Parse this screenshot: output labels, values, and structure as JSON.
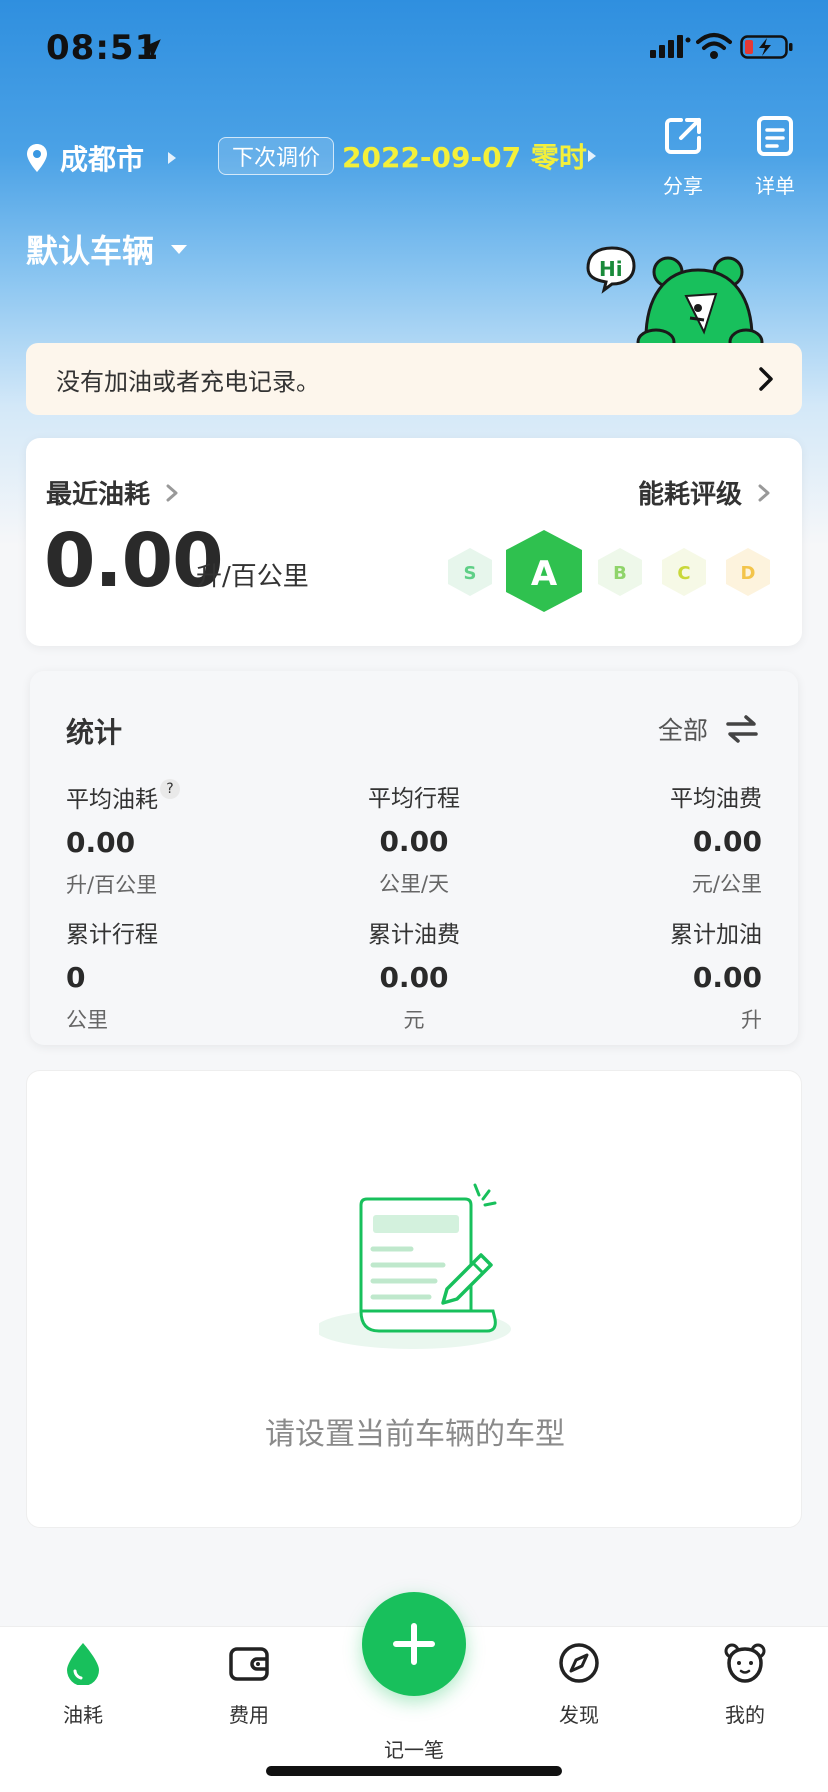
{
  "status_bar": {
    "time": "08:51"
  },
  "header": {
    "city": "成都市",
    "price_badge": "下次调价",
    "price_date": "2022-09-07 零时",
    "share_label": "分享",
    "detail_label": "详单",
    "vehicle": "默认车辆",
    "mascot_greeting": "Hi"
  },
  "notice": {
    "text": "没有加油或者充电记录。"
  },
  "consumption": {
    "recent_title": "最近油耗",
    "value": "0.00",
    "unit": "升/百公里",
    "rating_title": "能耗评级",
    "grades": [
      "S",
      "A",
      "B",
      "C",
      "D"
    ],
    "active_grade": "A"
  },
  "stats": {
    "title": "统计",
    "filter": "全部",
    "items": [
      {
        "label": "平均油耗",
        "value": "0.00",
        "unit": "升/百公里"
      },
      {
        "label": "平均行程",
        "value": "0.00",
        "unit": "公里/天"
      },
      {
        "label": "平均油费",
        "value": "0.00",
        "unit": "元/公里"
      },
      {
        "label": "累计行程",
        "value": "0",
        "unit": "公里"
      },
      {
        "label": "累计油费",
        "value": "0.00",
        "unit": "元"
      },
      {
        "label": "累计加油",
        "value": "0.00",
        "unit": "升"
      }
    ],
    "help_mark": "?"
  },
  "empty_state": {
    "text": "请设置当前车辆的车型"
  },
  "tab_bar": {
    "fuel": "油耗",
    "cost": "费用",
    "record": "记一笔",
    "discover": "发现",
    "mine": "我的"
  },
  "colors": {
    "accent_green": "#18c05c",
    "header_blue": "#2f8fdf",
    "date_yellow": "#f4f03a"
  },
  "icons": {
    "location": "pin-icon",
    "share": "share-icon",
    "detail": "list-icon",
    "fuel": "droplet-icon",
    "cost": "wallet-icon",
    "add": "plus-icon",
    "discover": "compass-icon",
    "mine": "bear-icon"
  }
}
